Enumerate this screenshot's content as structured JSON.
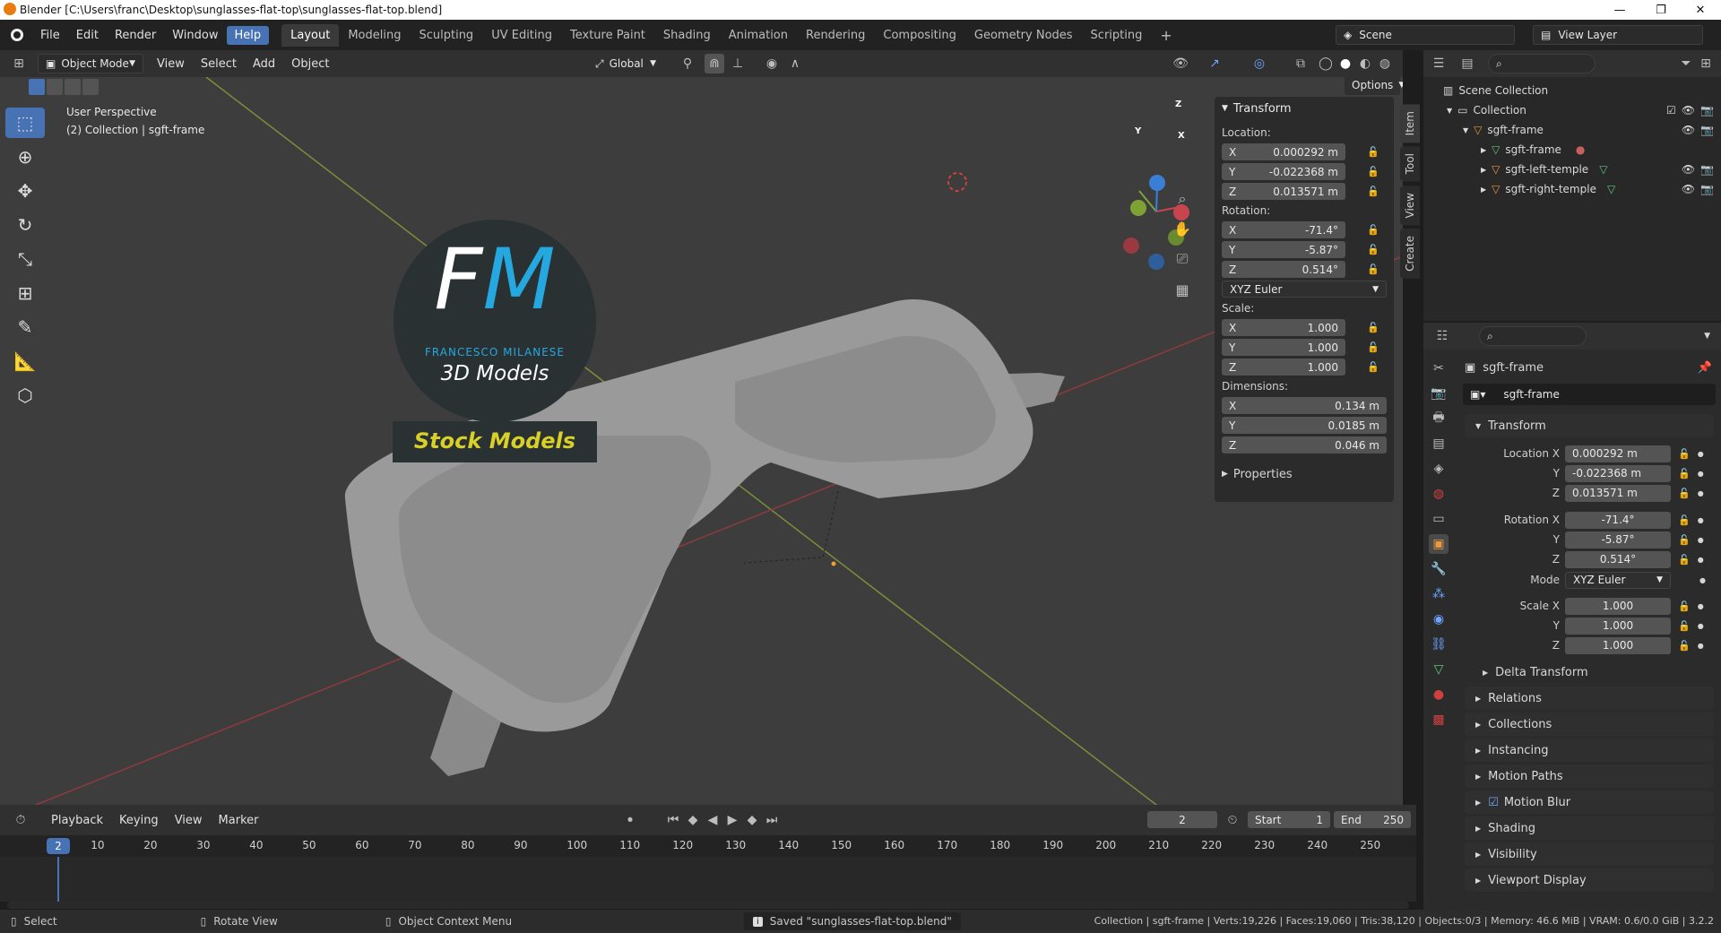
{
  "window": {
    "title": "Blender [C:\\Users\\franc\\Desktop\\sunglasses-flat-top\\sunglasses-flat-top.blend]",
    "min": "—",
    "max": "❐",
    "close": "✕"
  },
  "menu": {
    "items": [
      "File",
      "Edit",
      "Render",
      "Window",
      "Help"
    ]
  },
  "workspaces": [
    "Layout",
    "Modeling",
    "Sculpting",
    "UV Editing",
    "Texture Paint",
    "Shading",
    "Animation",
    "Rendering",
    "Compositing",
    "Geometry Nodes",
    "Scripting"
  ],
  "scene": {
    "label": "Scene",
    "view_layer": "View Layer"
  },
  "viewport_header": {
    "mode": "Object Mode",
    "view": "View",
    "select": "Select",
    "add": "Add",
    "object": "Object",
    "orientation": "Global",
    "options": "Options"
  },
  "viewport": {
    "perspective": "User Perspective",
    "collection_info": "(2) Collection | sgft-frame"
  },
  "watermark": {
    "initials_f": "F",
    "initials_m": "M",
    "name": "FRANCESCO MILANESE",
    "line2": "3D Models",
    "banner": "Stock Models"
  },
  "gizmo": {
    "x": "X",
    "y": "Y",
    "z": "Z"
  },
  "npanel": {
    "title": "Transform",
    "location_label": "Location:",
    "location": [
      {
        "axis": "X",
        "value": "0.000292 m"
      },
      {
        "axis": "Y",
        "value": "-0.022368 m"
      },
      {
        "axis": "Z",
        "value": "0.013571 m"
      }
    ],
    "rotation_label": "Rotation:",
    "rotation": [
      {
        "axis": "X",
        "value": "-71.4°"
      },
      {
        "axis": "Y",
        "value": "-5.87°"
      },
      {
        "axis": "Z",
        "value": "0.514°"
      }
    ],
    "rotation_mode": "XYZ Euler",
    "scale_label": "Scale:",
    "scale": [
      {
        "axis": "X",
        "value": "1.000"
      },
      {
        "axis": "Y",
        "value": "1.000"
      },
      {
        "axis": "Z",
        "value": "1.000"
      }
    ],
    "dimensions_label": "Dimensions:",
    "dimensions": [
      {
        "axis": "X",
        "value": "0.134 m"
      },
      {
        "axis": "Y",
        "value": "0.0185 m"
      },
      {
        "axis": "Z",
        "value": "0.046 m"
      }
    ],
    "properties": "Properties",
    "tabs": [
      "Item",
      "Tool",
      "View",
      "Create"
    ]
  },
  "outliner": {
    "scene_collection": "Scene Collection",
    "collection": "Collection",
    "items": [
      {
        "name": "sgft-frame",
        "indent": 1
      },
      {
        "name": "sgft-frame",
        "indent": 2
      },
      {
        "name": "sgft-left-temple",
        "indent": 2
      },
      {
        "name": "sgft-right-temple",
        "indent": 2
      }
    ]
  },
  "properties": {
    "object_name": "sgft-frame",
    "object_field": "sgft-frame",
    "transform": "Transform",
    "location": [
      {
        "label": "Location X",
        "value": "0.000292 m"
      },
      {
        "label": "Y",
        "value": "-0.022368 m"
      },
      {
        "label": "Z",
        "value": "0.013571 m"
      }
    ],
    "rotation": [
      {
        "label": "Rotation X",
        "value": "-71.4°"
      },
      {
        "label": "Y",
        "value": "-5.87°"
      },
      {
        "label": "Z",
        "value": "0.514°"
      }
    ],
    "mode_label": "Mode",
    "mode_value": "XYZ Euler",
    "scale": [
      {
        "label": "Scale X",
        "value": "1.000"
      },
      {
        "label": "Y",
        "value": "1.000"
      },
      {
        "label": "Z",
        "value": "1.000"
      }
    ],
    "delta": "Delta Transform",
    "sections": [
      "Relations",
      "Collections",
      "Instancing",
      "Motion Paths",
      "Motion Blur",
      "Shading",
      "Visibility",
      "Viewport Display"
    ]
  },
  "timeline": {
    "playback": "Playback",
    "keying": "Keying",
    "view": "View",
    "marker": "Marker",
    "current_frame": "2",
    "start_label": "Start",
    "start": "1",
    "end_label": "End",
    "end": "250",
    "ticks": [
      "10",
      "20",
      "30",
      "40",
      "50",
      "60",
      "70",
      "80",
      "90",
      "100",
      "110",
      "120",
      "130",
      "140",
      "150",
      "160",
      "170",
      "180",
      "190",
      "200",
      "210",
      "220",
      "230",
      "240",
      "250"
    ],
    "frame_badge": "2"
  },
  "status": {
    "select": "Select",
    "rotate": "Rotate View",
    "context": "Object Context Menu",
    "saved": "Saved \"sunglasses-flat-top.blend\"",
    "stats": "Collection | sgft-frame | Verts:19,226 | Faces:19,060 | Tris:38,120 | Objects:0/3 | Memory: 46.6 MiB | VRAM: 0.6/0.0 GiB | 3.2.2"
  },
  "colors": {
    "accent": "#4772b3",
    "x_axis": "#c8444e",
    "y_axis": "#7fa235",
    "z_axis": "#3a7fd6"
  }
}
